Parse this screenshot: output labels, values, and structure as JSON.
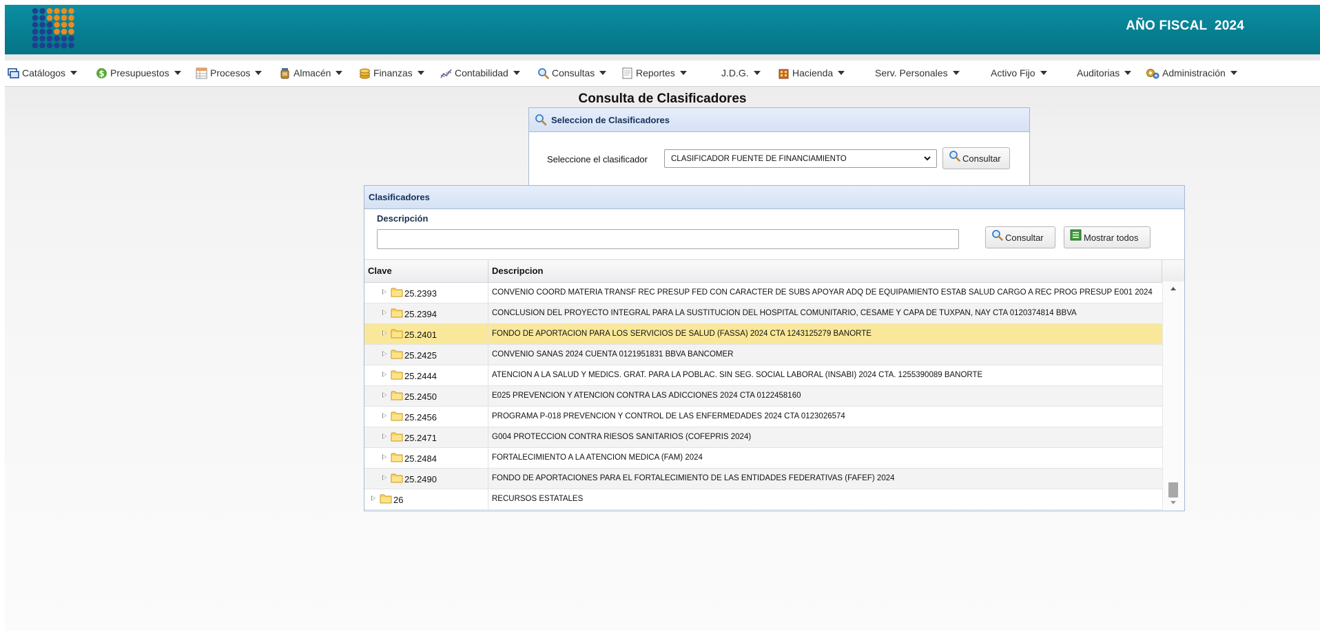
{
  "header": {
    "fiscal_year_label": "AÑO FISCAL  2024",
    "logo_icon": "dot-grid-logo",
    "colors": {
      "banner": "#0a889c",
      "selected_row": "#fae89a",
      "panel_header": "#dbe6f6"
    }
  },
  "menu": [
    {
      "label": "Catálogos",
      "icon": "window-icon"
    },
    {
      "label": "Presupuestos",
      "icon": "dollar-icon"
    },
    {
      "label": "Procesos",
      "icon": "spreadsheet-icon"
    },
    {
      "label": "Almacén",
      "icon": "jar-icon"
    },
    {
      "label": "Finanzas",
      "icon": "coins-icon"
    },
    {
      "label": "Contabilidad",
      "icon": "line-chart-icon"
    },
    {
      "label": "Consultas",
      "icon": "magnifier-icon"
    },
    {
      "label": "Reportes",
      "icon": "document-icon"
    },
    {
      "label": "J.D.G."
    },
    {
      "label": "Hacienda",
      "icon": "building-icon"
    },
    {
      "label": "Serv. Personales"
    },
    {
      "label": "Activo Fijo"
    },
    {
      "label": "Auditorias"
    },
    {
      "label": "Administración",
      "icon": "gears-icon"
    }
  ],
  "page": {
    "title": "Consulta de Clasificadores"
  },
  "selector_panel": {
    "title": "Seleccion de Clasificadores",
    "label": "Seleccione el clasificador",
    "selected_value": "CLASIFICADOR FUENTE DE FINANCIAMIENTO",
    "button_label": "Consultar"
  },
  "classifiers_panel": {
    "title": "Clasificadores",
    "description_label": "Descripción",
    "description_value": "",
    "consult_button": "Consultar",
    "show_all_button": "Mostrar todos",
    "columns": {
      "clave": "Clave",
      "descripcion": "Descripcion"
    },
    "rows": [
      {
        "clave": "25.2393",
        "desc": "CONVENIO COORD MATERIA TRANSF REC PRESUP FED CON CARACTER DE SUBS APOYAR ADQ DE EQUIPAMIENTO ESTAB SALUD CARGO A REC PROG PRESUP E001 2024",
        "level": 2,
        "selected": false
      },
      {
        "clave": "25.2394",
        "desc": "CONCLUSION DEL PROYECTO INTEGRAL PARA LA SUSTITUCION DEL HOSPITAL COMUNITARIO, CESAME Y CAPA DE TUXPAN, NAY CTA 0120374814 BBVA",
        "level": 2,
        "selected": false
      },
      {
        "clave": "25.2401",
        "desc": "FONDO DE APORTACION PARA LOS SERVICIOS DE SALUD (FASSA) 2024 CTA 1243125279 BANORTE",
        "level": 2,
        "selected": true
      },
      {
        "clave": "25.2425",
        "desc": "CONVENIO SANAS 2024 CUENTA 0121951831 BBVA BANCOMER",
        "level": 2,
        "selected": false
      },
      {
        "clave": "25.2444",
        "desc": "ATENCION A LA SALUD Y MEDICS. GRAT. PARA LA POBLAC. SIN SEG. SOCIAL LABORAL (INSABI) 2024 CTA. 1255390089 BANORTE",
        "level": 2,
        "selected": false
      },
      {
        "clave": "25.2450",
        "desc": "E025 PREVENCION Y ATENCION CONTRA LAS ADICCIONES 2024 CTA 0122458160",
        "level": 2,
        "selected": false
      },
      {
        "clave": "25.2456",
        "desc": "PROGRAMA P-018 PREVENCION Y CONTROL DE LAS ENFERMEDADES 2024 CTA 0123026574",
        "level": 2,
        "selected": false
      },
      {
        "clave": "25.2471",
        "desc": "G004 PROTECCION CONTRA RIESOS SANITARIOS (COFEPRIS 2024)",
        "level": 2,
        "selected": false
      },
      {
        "clave": "25.2484",
        "desc": "FORTALECIMIENTO A LA ATENCION MEDICA (FAM) 2024",
        "level": 2,
        "selected": false
      },
      {
        "clave": "25.2490",
        "desc": "FONDO DE APORTACIONES PARA EL FORTALECIMIENTO DE LAS ENTIDADES FEDERATIVAS (FAFEF) 2024",
        "level": 2,
        "selected": false
      },
      {
        "clave": "26",
        "desc": "RECURSOS ESTATALES",
        "level": 1,
        "selected": false
      }
    ]
  }
}
